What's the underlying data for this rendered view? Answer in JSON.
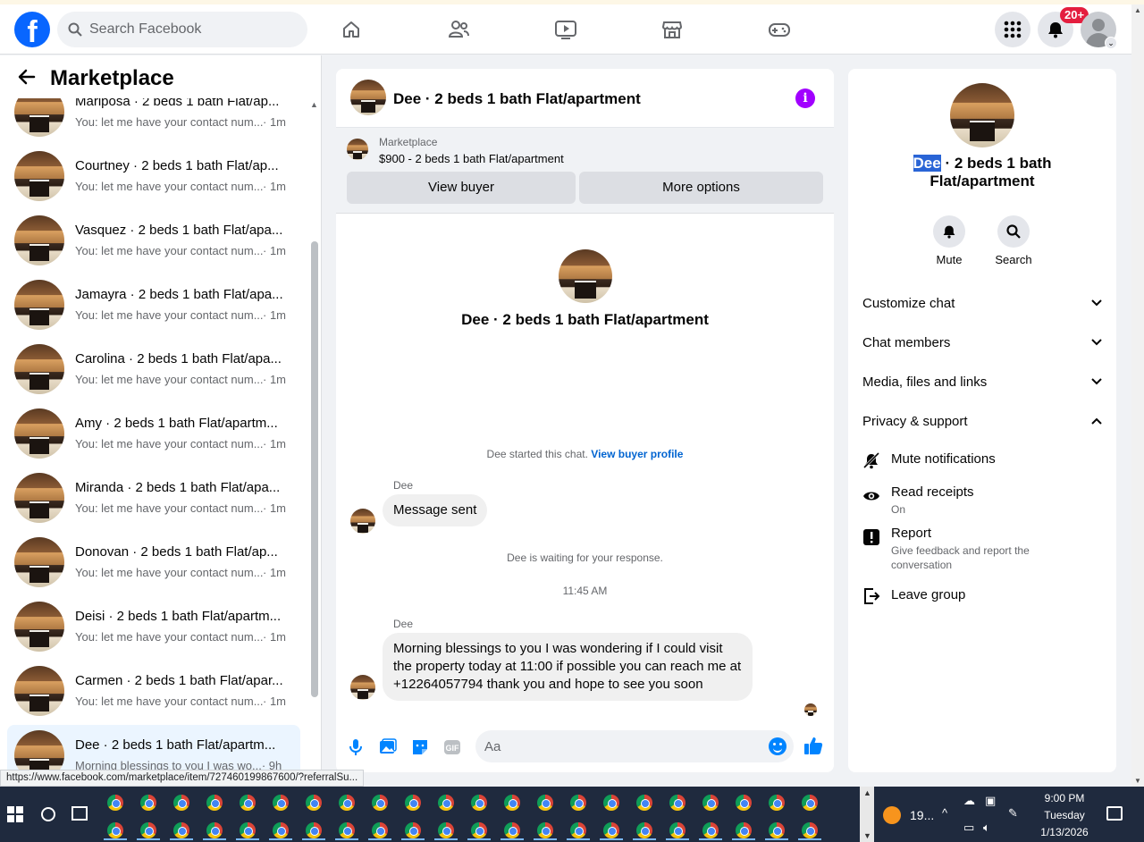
{
  "topbar": {
    "logo": "f",
    "search_placeholder": "Search Facebook",
    "nav_icons": [
      "home-icon",
      "friends-icon",
      "watch-icon",
      "marketplace-icon",
      "gaming-icon"
    ],
    "notification_badge": "20+"
  },
  "sidebar": {
    "title": "Marketplace",
    "conversations": [
      {
        "name": "Mariposa · 2 beds 1 bath Flat/ap...",
        "snippet": "You: let me have your contact num...",
        "time": "· 1m"
      },
      {
        "name": "Courtney · 2 beds 1 bath Flat/ap...",
        "snippet": "You: let me have your contact num...",
        "time": "· 1m"
      },
      {
        "name": "Vasquez · 2 beds 1 bath Flat/apa...",
        "snippet": "You: let me have your contact num...",
        "time": "· 1m"
      },
      {
        "name": "Jamayra · 2 beds 1 bath Flat/apa...",
        "snippet": "You: let me have your contact num...",
        "time": "· 1m"
      },
      {
        "name": "Carolina · 2 beds 1 bath Flat/apa...",
        "snippet": "You: let me have your contact num...",
        "time": "· 1m"
      },
      {
        "name": "Amy · 2 beds 1 bath Flat/apartm...",
        "snippet": "You: let me have your contact num...",
        "time": "· 1m"
      },
      {
        "name": "Miranda · 2 beds 1 bath Flat/apa...",
        "snippet": "You: let me have your contact num...",
        "time": "· 1m"
      },
      {
        "name": "Donovan · 2 beds 1 bath Flat/ap...",
        "snippet": "You: let me have your contact num...",
        "time": "· 1m"
      },
      {
        "name": "Deisi · 2 beds 1 bath Flat/apartm...",
        "snippet": "You: let me have your contact num...",
        "time": "· 1m"
      },
      {
        "name": "Carmen · 2 beds 1 bath Flat/apar...",
        "snippet": "You: let me have your contact num...",
        "time": "· 1m"
      },
      {
        "name": "Dee · 2 beds 1 bath Flat/apartm...",
        "snippet": "Morning blessings to you I was wo...",
        "time": "· 9h"
      }
    ]
  },
  "chat": {
    "title": "Dee · 2 beds 1 bath Flat/apartment",
    "marketplace_label": "Marketplace",
    "listing": "$900 - 2 beds 1 bath Flat/apartment",
    "view_buyer": "View buyer",
    "more_options": "More options",
    "center_title": "Dee · 2 beds 1 bath Flat/apartment",
    "started_text": "Dee started this chat.",
    "view_buyer_profile": "View buyer profile",
    "sender1": "Dee",
    "msg1": "Message sent",
    "waiting": "Dee is waiting for your response.",
    "timestamp": "11:45 AM",
    "sender2": "Dee",
    "msg2": "Morning blessings to you I was wondering if I could visit the property today at 11:00 if possible you can reach me at +12264057794 thank you and hope to see you soon",
    "composer_placeholder": "Aa"
  },
  "rpanel": {
    "title_highlight": "Dee",
    "title_rest": " · 2 beds 1 bath Flat/apartment",
    "mute": "Mute",
    "search": "Search",
    "customize": "Customize chat",
    "members": "Chat members",
    "media": "Media, files and links",
    "privacy": "Privacy & support",
    "mute_notifications": "Mute notifications",
    "read_receipts": "Read receipts",
    "read_receipts_state": "On",
    "report": "Report",
    "report_sub": "Give feedback and report the conversation",
    "leave": "Leave group"
  },
  "status_url": "https://www.facebook.com/marketplace/item/727460199867600/?referralSu...",
  "taskbar": {
    "weather": "19...",
    "clock_time": "9:00 PM",
    "clock_day": "Tuesday",
    "clock_date": "1/13/2026"
  }
}
